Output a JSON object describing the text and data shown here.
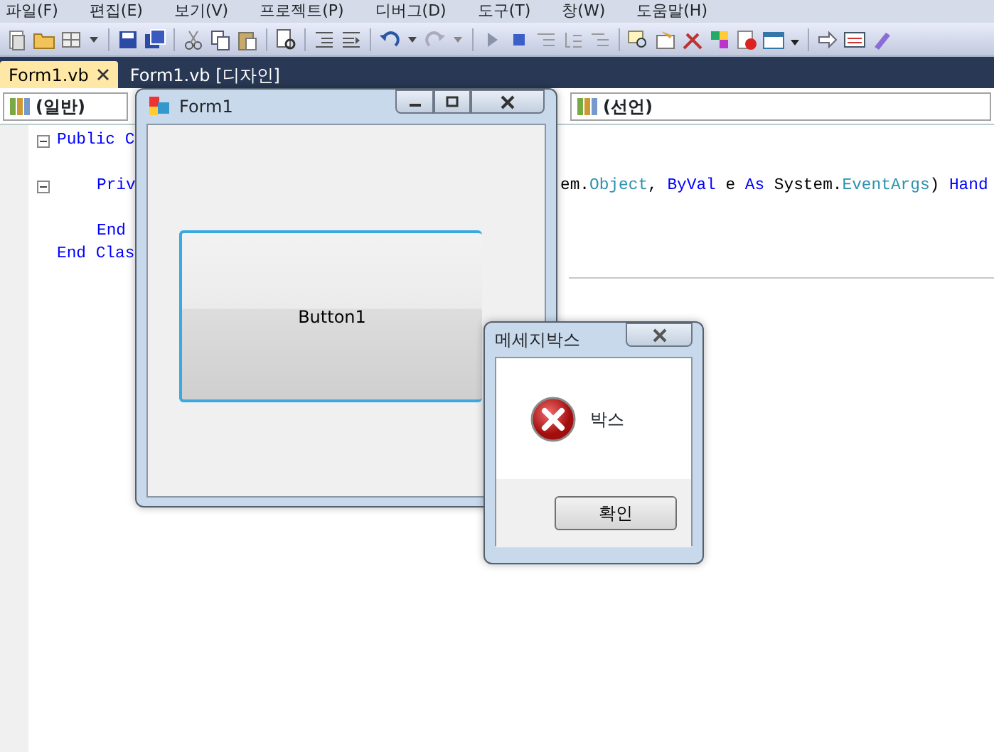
{
  "menu": [
    {
      "label": "파일(F)"
    },
    {
      "label": "편집(E)"
    },
    {
      "label": "보기(V)"
    },
    {
      "label": "프로젝트(P)"
    },
    {
      "label": "디버그(D)"
    },
    {
      "label": "도구(T)"
    },
    {
      "label": "창(W)"
    },
    {
      "label": "도움말(H)"
    }
  ],
  "tabs": [
    {
      "label": "Form1.vb",
      "selected": true,
      "closable": true
    },
    {
      "label": "Form1.vb [디자인]",
      "selected": false,
      "closable": false
    }
  ],
  "code_bar": {
    "left": "(일반)",
    "right": "(선언)"
  },
  "code_lines": [
    {
      "expanded": true,
      "tokens": [
        {
          "kind": "keyword",
          "text": "Public C"
        }
      ],
      "children": [
        {
          "expanded": true,
          "tokens": [
            {
              "kind": "keyword",
              "text": "Priv"
            }
          ],
          "tail": [
            {
              "kind": "plain",
              "text": "em."
            },
            {
              "kind": "type",
              "text": "Object"
            },
            {
              "kind": "plain",
              "text": ", "
            },
            {
              "kind": "keyword",
              "text": "ByVal"
            },
            {
              "kind": "plain",
              "text": " e "
            },
            {
              "kind": "keyword",
              "text": "As"
            },
            {
              "kind": "plain",
              "text": " System."
            },
            {
              "kind": "type",
              "text": "EventArgs"
            },
            {
              "kind": "plain",
              "text": ") "
            },
            {
              "kind": "keyword",
              "text": "Hand"
            }
          ]
        },
        {
          "tokens": [
            {
              "kind": "keyword",
              "text": "End "
            }
          ]
        }
      ]
    },
    {
      "tokens": [
        {
          "kind": "keyword",
          "text": "End Clas"
        }
      ]
    }
  ],
  "form_window": {
    "title": "Form1",
    "button": {
      "label": "Button1",
      "focused": true
    }
  },
  "message_box": {
    "title": "메세지박스",
    "message": "박스",
    "button": "확인"
  }
}
